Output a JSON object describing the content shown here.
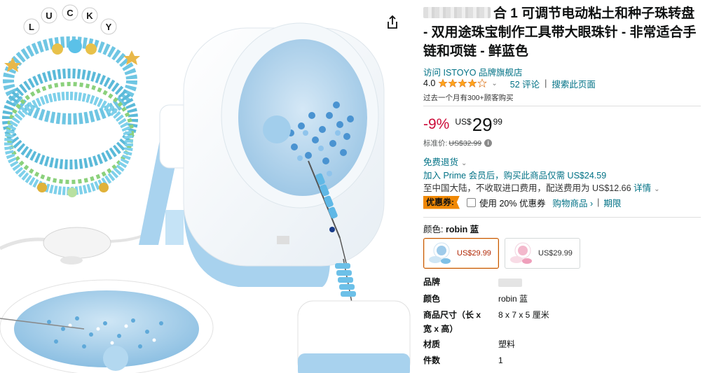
{
  "product": {
    "title_rest": "合 1 可调节电动粘土和种子珠转盘 - 双用途珠宝制作工具带大眼珠针 - 非常适合手链和项链 - 鲜蓝色",
    "store_link": "访问 ISTOYO 品牌旗舰店",
    "rating": "4.0",
    "review_count": "52 评论",
    "search_page": "搜索此页面",
    "bought_recently": "过去一个月有300+顾客购买"
  },
  "price": {
    "discount": "-9%",
    "currency": "US$",
    "whole": "29",
    "fraction": "99",
    "list_label": "标准价:",
    "list_price": "US$32.99"
  },
  "delivery": {
    "free_return": "免费退货",
    "prime_offer": "加入 Prime 会员后，购买此商品仅需 US$24.59",
    "shipping": "至中国大陆，不收取进口费用，配送费用为 US$12.66",
    "shipping_details": "详情"
  },
  "coupon": {
    "badge": "优惠券:",
    "apply_text": "使用 20% 优惠券",
    "shop_items": "购物商品 ›",
    "terms": "期限"
  },
  "color": {
    "label": "颜色:",
    "selected": "robin 蓝",
    "options": [
      {
        "price": "US$29.99"
      },
      {
        "price": "US$29.99"
      }
    ]
  },
  "specs": [
    {
      "key": "品牌",
      "value": ""
    },
    {
      "key": "颜色",
      "value": "robin 蓝"
    },
    {
      "key": "商品尺寸（长 x 宽 x 高）",
      "value": "8 x 7 x 5 厘米"
    },
    {
      "key": "材质",
      "value": "塑料"
    },
    {
      "key": "件数",
      "value": "1"
    }
  ],
  "icons": {
    "share": "share-icon",
    "info": "info-icon",
    "star": "star-icon",
    "chevron": "chevron-down-icon"
  },
  "image": {
    "bead_letters": [
      "L",
      "U",
      "C",
      "K",
      "Y"
    ]
  },
  "colors": {
    "link": "#007185",
    "discount": "#cc0c39",
    "coupon": "#f08804",
    "star": "#ffa41c",
    "machine_blue": "#a8d2ee"
  }
}
